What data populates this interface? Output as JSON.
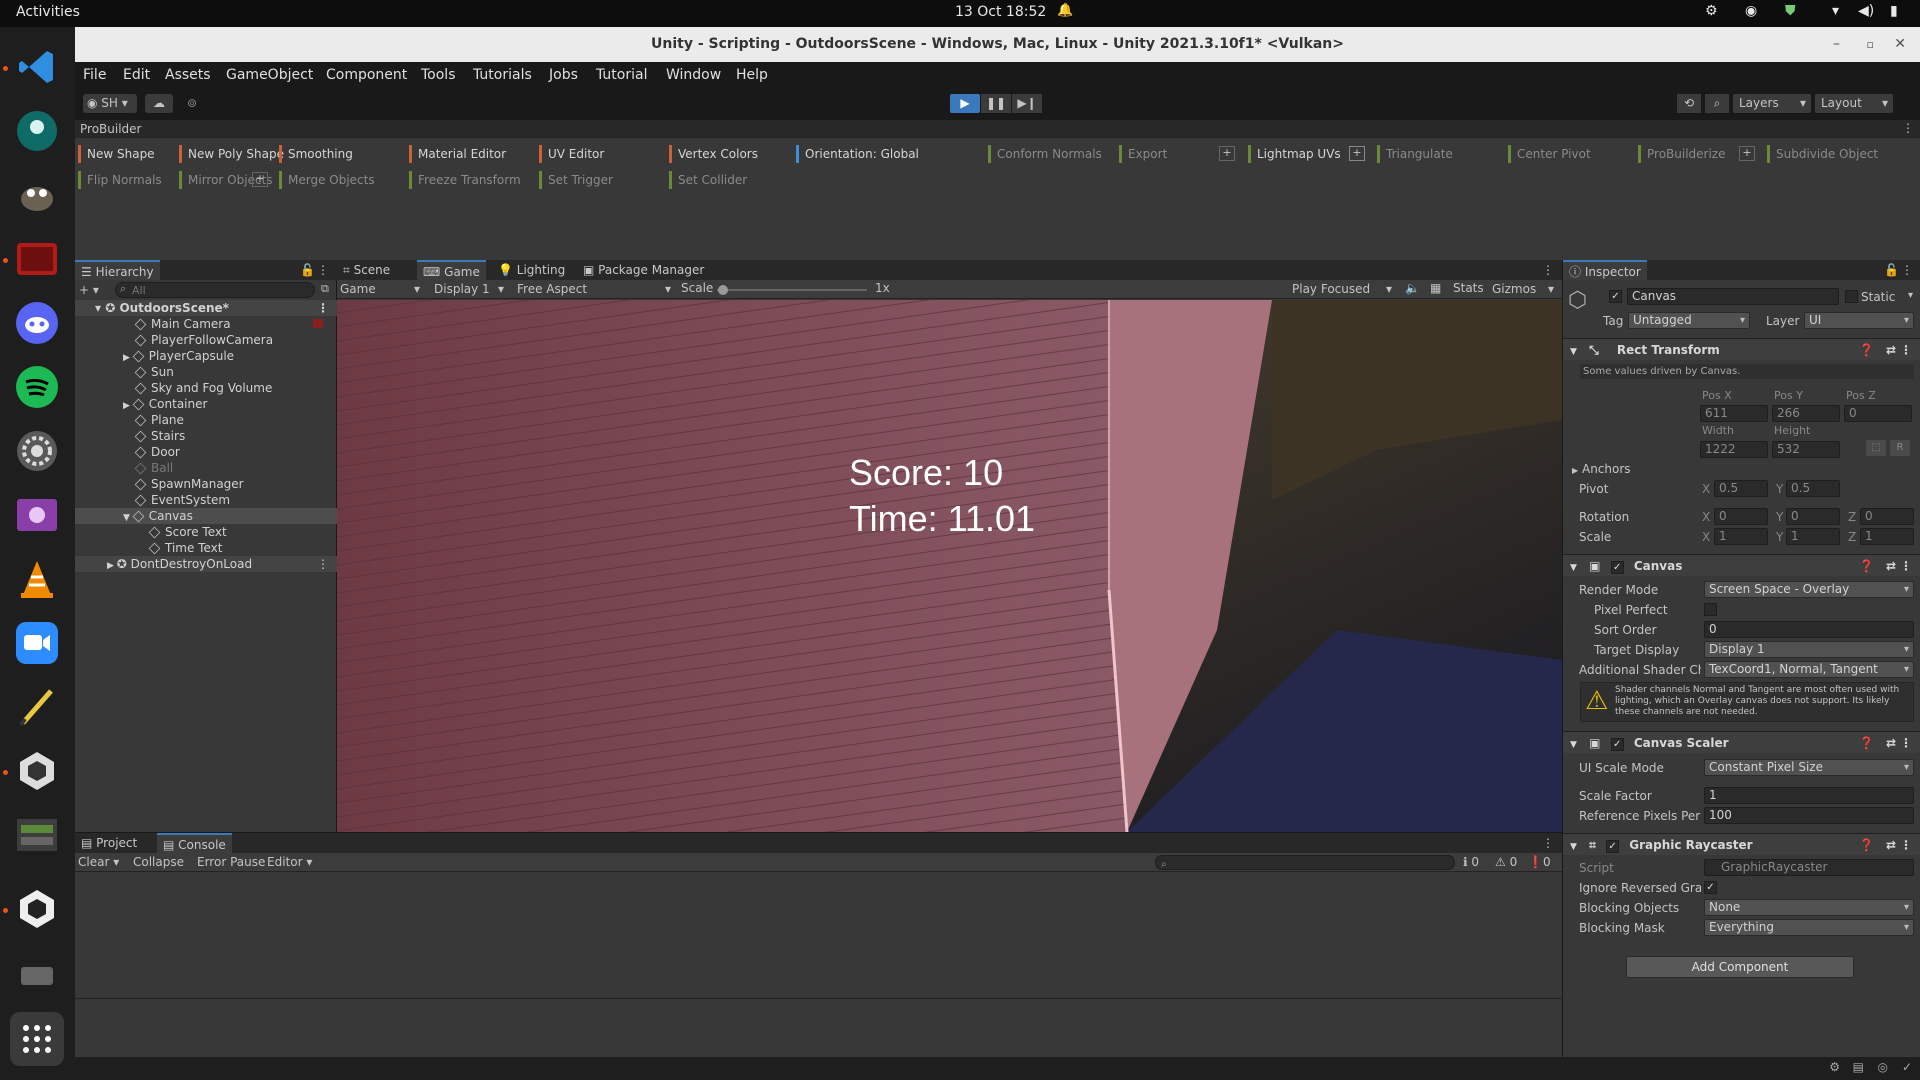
{
  "topbar": {
    "activities": "Activities",
    "clock": "13 Oct  18:52"
  },
  "window": {
    "title": "Unity - Scripting - OutdoorsScene - Windows, Mac, Linux - Unity 2021.3.10f1* <Vulkan>"
  },
  "menu": [
    "File",
    "Edit",
    "Assets",
    "GameObject",
    "Component",
    "Tools",
    "Tutorials",
    "Jobs",
    "Tutorial",
    "Window",
    "Help"
  ],
  "toolbar": {
    "account": "SH",
    "layers": "Layers",
    "layout": "Layout"
  },
  "probuilder": {
    "title": "ProBuilder",
    "row1": [
      "New Shape",
      "New Poly Shape",
      "Smoothing",
      "Material Editor",
      "UV Editor",
      "Vertex Colors",
      "Orientation: Global",
      "Conform Normals",
      "Export",
      "Lightmap UVs",
      "Triangulate",
      "Center Pivot",
      "ProBuilderize",
      "Subdivide Object"
    ],
    "row2": [
      "Flip Normals",
      "Mirror Objects",
      "Merge Objects",
      "Freeze Transform",
      "Set Trigger",
      "Set Collider"
    ]
  },
  "hierarchy": {
    "tab": "Hierarchy",
    "search_placeholder": "All",
    "scene": "OutdoorsScene*",
    "items": [
      "Main Camera",
      "PlayerFollowCamera",
      "PlayerCapsule",
      "Sun",
      "Sky and Fog Volume",
      "Container",
      "Plane",
      "Stairs",
      "Door",
      "Ball",
      "SpawnManager",
      "EventSystem",
      "Canvas",
      "Score Text",
      "Time Text"
    ],
    "ddol": "DontDestroyOnLoad"
  },
  "gameview": {
    "tabs": [
      "Scene",
      "Game",
      "Lighting",
      "Package Manager"
    ],
    "game_dd": "Game",
    "display_dd": "Display 1",
    "aspect_dd": "Free Aspect",
    "scale_label": "Scale",
    "scale_value": "1x",
    "play_focused": "Play Focused",
    "stats": "Stats",
    "gizmos": "Gizmos",
    "score": "Score: 10",
    "time": "Time: 11.01"
  },
  "console": {
    "tabs": [
      "Project",
      "Console"
    ],
    "buttons": [
      "Clear",
      "Collapse",
      "Error Pause",
      "Editor"
    ],
    "counts": [
      "0",
      "0",
      "0"
    ]
  },
  "inspector": {
    "tab": "Inspector",
    "object_name": "Canvas",
    "static": "Static",
    "tag_label": "Tag",
    "tag": "Untagged",
    "layer_label": "Layer",
    "layer": "UI",
    "rect": {
      "title": "Rect Transform",
      "note": "Some values driven by Canvas.",
      "posx_l": "Pos X",
      "posy_l": "Pos Y",
      "posz_l": "Pos Z",
      "posx": "611",
      "posy": "266",
      "posz": "0",
      "width_l": "Width",
      "height_l": "Height",
      "width": "1222",
      "height": "532",
      "anchors": "Anchors",
      "pivot": "Pivot",
      "pivot_x": "0.5",
      "pivot_y": "0.5",
      "rotation": "Rotation",
      "rot_x": "0",
      "rot_y": "0",
      "rot_z": "0",
      "scale": "Scale",
      "sc_x": "1",
      "sc_y": "1",
      "sc_z": "1",
      "x": "X",
      "y": "Y",
      "z": "Z",
      "r": "R"
    },
    "canvas": {
      "title": "Canvas",
      "render_mode_l": "Render Mode",
      "render_mode": "Screen Space - Overlay",
      "pixel_perfect_l": "Pixel Perfect",
      "sort_order_l": "Sort Order",
      "sort_order": "0",
      "target_display_l": "Target Display",
      "target_display": "Display 1",
      "shader_l": "Additional Shader Cha",
      "shader": "TexCoord1, Normal, Tangent",
      "warning": "Shader channels Normal and Tangent are most often used with lighting, which an Overlay canvas does not support. Its likely these channels are not needed."
    },
    "scaler": {
      "title": "Canvas Scaler",
      "mode_l": "UI Scale Mode",
      "mode": "Constant Pixel Size",
      "factor_l": "Scale Factor",
      "factor": "1",
      "ref_l": "Reference Pixels Per U",
      "ref": "100"
    },
    "raycaster": {
      "title": "Graphic Raycaster",
      "script_l": "Script",
      "script": "GraphicRaycaster",
      "ignore_l": "Ignore Reversed Grap",
      "blocking_obj_l": "Blocking Objects",
      "blocking_obj": "None",
      "blocking_mask_l": "Blocking Mask",
      "blocking_mask": "Everything"
    },
    "add_component": "Add Component"
  }
}
